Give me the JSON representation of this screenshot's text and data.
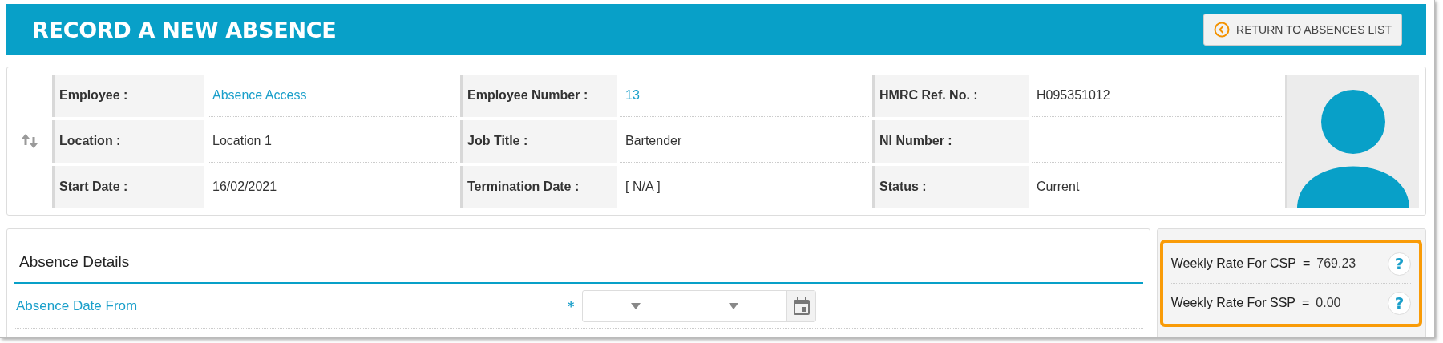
{
  "header": {
    "title": "RECORD A NEW ABSENCE",
    "return_button": "RETURN TO ABSENCES LIST"
  },
  "employee": {
    "rows": [
      [
        {
          "label": "Employee :",
          "value": "Absence Access",
          "kind": "link"
        },
        {
          "label": "Employee Number :",
          "value": "13",
          "kind": "link"
        },
        {
          "label": "HMRC Ref. No. :",
          "value": "H095351012",
          "kind": "text"
        }
      ],
      [
        {
          "label": "Location :",
          "value": "Location 1",
          "kind": "text"
        },
        {
          "label": "Job Title :",
          "value": "Bartender",
          "kind": "text"
        },
        {
          "label": "NI Number :"
        }
      ],
      [
        {
          "label": "Start Date :",
          "value": "16/02/2021",
          "kind": "text"
        },
        {
          "label": "Termination Date :",
          "value": "[ N/A ]",
          "kind": "text"
        },
        {
          "label": "Status :",
          "value": "Current",
          "kind": "text"
        }
      ]
    ]
  },
  "absence_details": {
    "title": "Absence Details",
    "fields": [
      {
        "label": "Absence Date From",
        "required_mark": "*"
      }
    ]
  },
  "rates": [
    {
      "label": "Weekly Rate For CSP",
      "equals": "=",
      "value": "769.23",
      "help": "?"
    },
    {
      "label": "Weekly Rate For SSP",
      "equals": "=",
      "value": "0.00",
      "help": "?"
    }
  ]
}
